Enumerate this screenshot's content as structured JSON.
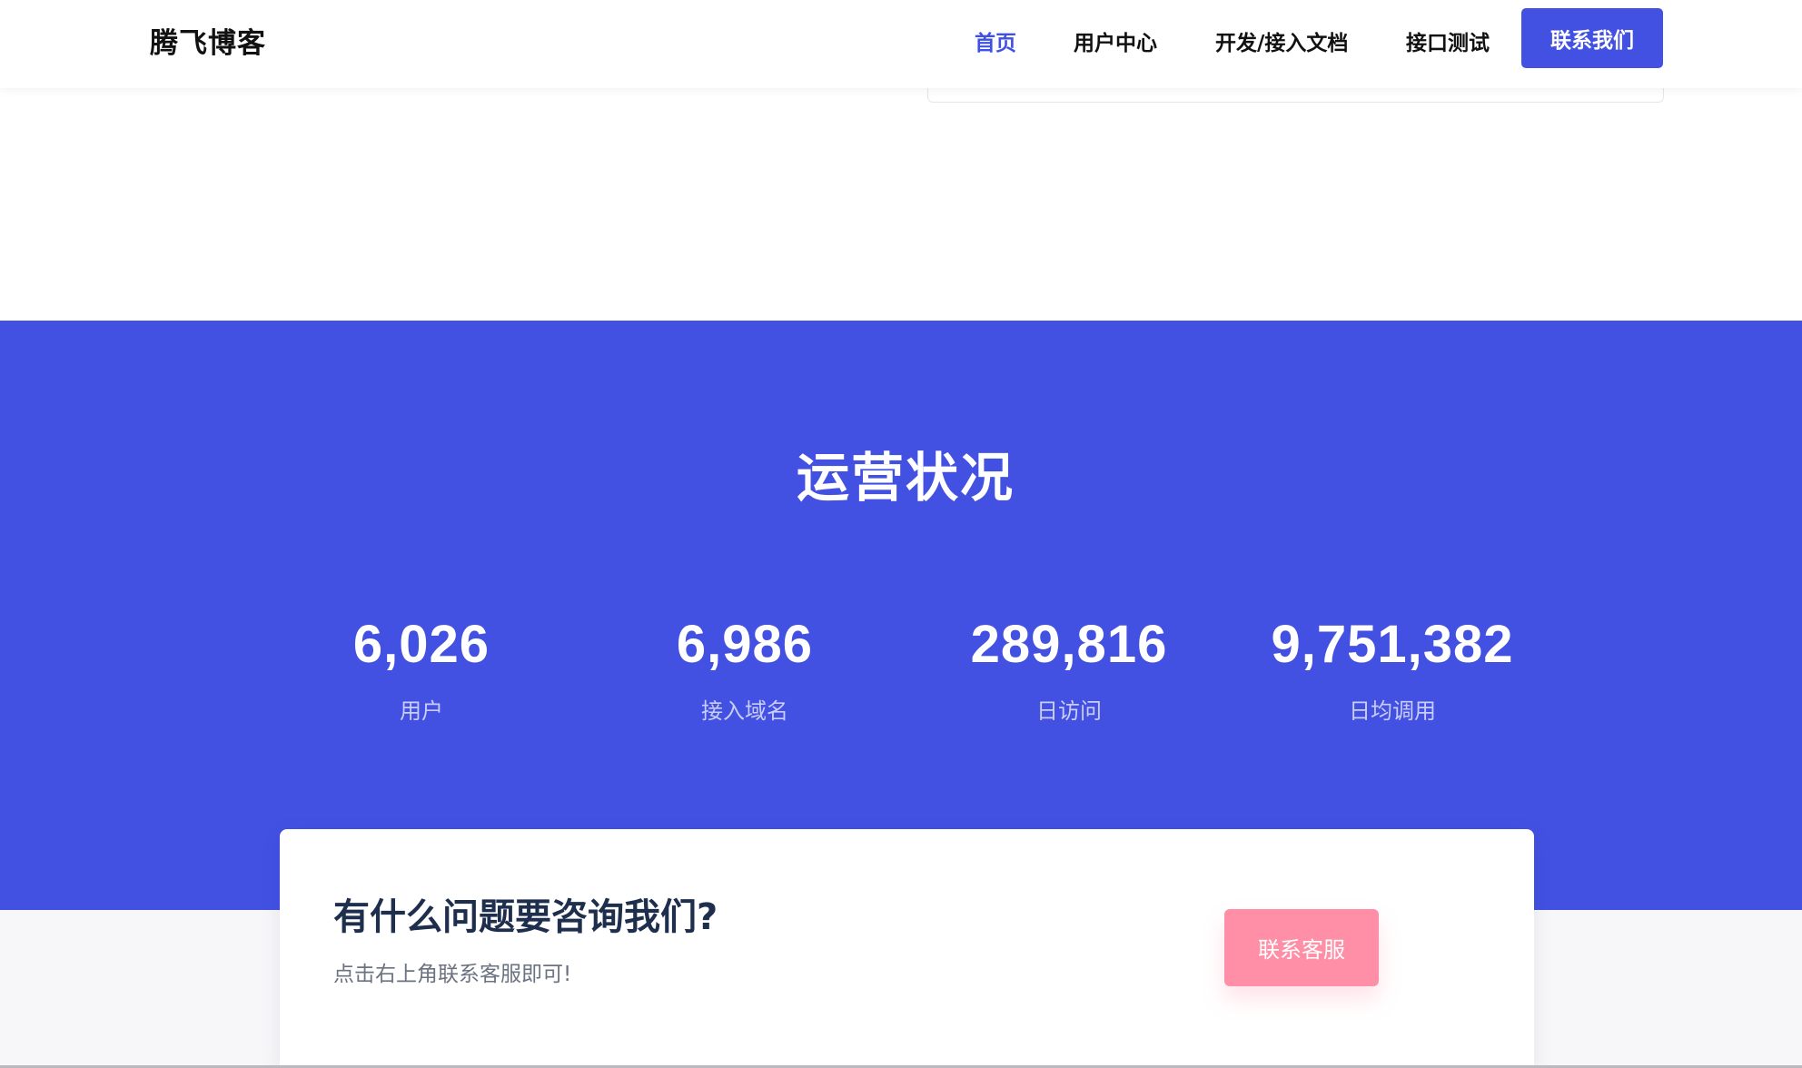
{
  "header": {
    "brand": "腾飞博客",
    "nav": [
      {
        "label": "首页",
        "active": true
      },
      {
        "label": "用户中心",
        "active": false
      },
      {
        "label": "开发/接入文档",
        "active": false
      },
      {
        "label": "接口测试",
        "active": false
      }
    ],
    "cta_label": "联系我们"
  },
  "stats": {
    "title": "运营状况",
    "items": [
      {
        "value": "6,026",
        "label": "用户"
      },
      {
        "value": "6,986",
        "label": "接入域名"
      },
      {
        "value": "289,816",
        "label": "日访问"
      },
      {
        "value": "9,751,382",
        "label": "日均调用"
      }
    ]
  },
  "contact": {
    "title": "有什么问题要咨询我们?",
    "subtitle": "点击右上角联系客服即可!",
    "button_label": "联系客服"
  },
  "colors": {
    "brand_blue": "#4351e3",
    "accent_pink": "#ff8fa6",
    "heading_dark": "#1e2e4d"
  }
}
